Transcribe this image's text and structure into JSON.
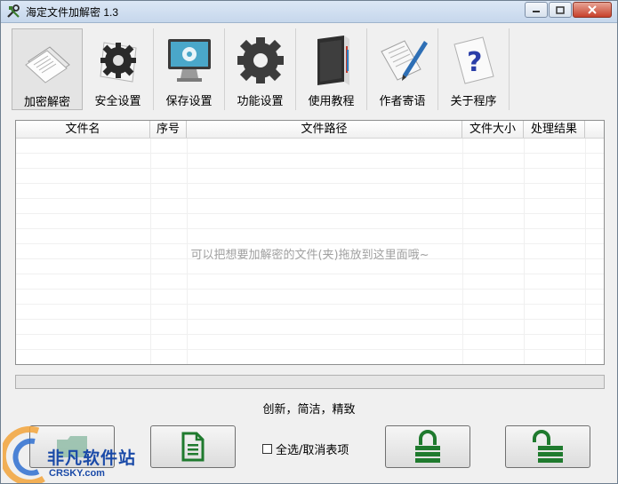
{
  "window": {
    "title": "海定文件加解密 1.3"
  },
  "toolbar": {
    "items": [
      {
        "label": "加密解密",
        "icon": "papers-icon",
        "active": true
      },
      {
        "label": "安全设置",
        "icon": "gear-icon",
        "active": false
      },
      {
        "label": "保存设置",
        "icon": "monitor-gear-icon",
        "active": false
      },
      {
        "label": "功能设置",
        "icon": "cog-icon",
        "active": false
      },
      {
        "label": "使用教程",
        "icon": "book-icon",
        "active": false
      },
      {
        "label": "作者寄语",
        "icon": "pen-paper-icon",
        "active": false
      },
      {
        "label": "关于程序",
        "icon": "help-icon",
        "active": false
      }
    ]
  },
  "file_list": {
    "columns": [
      "文件名",
      "序号",
      "文件路径",
      "文件大小",
      "处理结果"
    ],
    "rows": [],
    "empty_hint": "可以把想要加解密的文件(夹)拖放到这里面哦~"
  },
  "progress": {
    "value": 0
  },
  "slogan": "创新，简洁，精致",
  "select_all": {
    "label": "全选/取消表项",
    "checked": false
  },
  "buttons": {
    "add_folder": "folder-icon",
    "add_file": "document-icon",
    "encrypt": "lock-icon",
    "decrypt": "unlock-icon"
  },
  "watermark": {
    "brand": "非凡软件站",
    "site": "CRSKY.com"
  },
  "colors": {
    "accent_green": "#1f7a2e",
    "title_bar": "#c6d7ec"
  }
}
